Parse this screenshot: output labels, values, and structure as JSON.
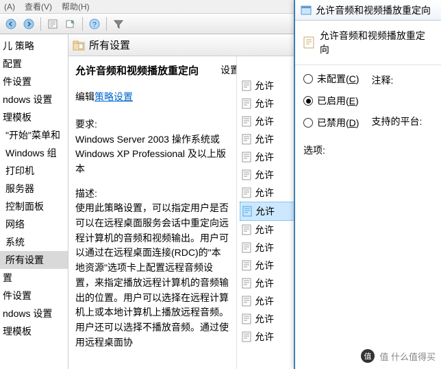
{
  "menubar": {
    "view": "查看(V)",
    "help": "帮助(H)",
    "prefix": "(A)"
  },
  "tree": {
    "items": [
      {
        "label": "儿 策略",
        "lvl": 1
      },
      {
        "label": "配置",
        "lvl": 1
      },
      {
        "label": "件设置",
        "lvl": 1
      },
      {
        "label": "ndows 设置",
        "lvl": 1
      },
      {
        "label": "理模板",
        "lvl": 1
      },
      {
        "label": "\"开始\"菜单和",
        "lvl": 2
      },
      {
        "label": "Windows 组",
        "lvl": 2
      },
      {
        "label": "打印机",
        "lvl": 2
      },
      {
        "label": "服务器",
        "lvl": 2
      },
      {
        "label": "控制面板",
        "lvl": 2
      },
      {
        "label": "网络",
        "lvl": 2
      },
      {
        "label": "系统",
        "lvl": 2
      },
      {
        "label": "所有设置",
        "lvl": 2,
        "sel": true
      },
      {
        "label": "置",
        "lvl": 1
      },
      {
        "label": "件设置",
        "lvl": 1
      },
      {
        "label": "ndows 设置",
        "lvl": 1
      },
      {
        "label": "理模板",
        "lvl": 1
      }
    ]
  },
  "content": {
    "header": "所有设置",
    "title": "允许音频和视频播放重定向",
    "edit_label": "编辑",
    "edit_link": "策略设置",
    "column_settings": "设置",
    "req_label": "要求:",
    "req_text": "Windows Server 2003 操作系统或 Windows XP Professional 及以上版本",
    "desc_label": "描述:",
    "desc_text": "使用此策略设置，可以指定用户是否可以在远程桌面服务会话中重定向远程计算机的音频和视频输出。用户可以通过在远程桌面连接(RDC)的\"本地资源\"选项卡上配置远程音频设置，来指定播放远程计算机的音频输出的位置。用户可以选择在远程计算机上或本地计算机上播放远程音频。用户还可以选择不播放音频。通过使用远程桌面协"
  },
  "setlist": {
    "items": [
      {
        "label": "允许"
      },
      {
        "label": "允许"
      },
      {
        "label": "允许"
      },
      {
        "label": "允许"
      },
      {
        "label": "允许"
      },
      {
        "label": "允许"
      },
      {
        "label": "允许"
      },
      {
        "label": "允许",
        "sel": true
      },
      {
        "label": "允许"
      },
      {
        "label": "允许"
      },
      {
        "label": "允许"
      },
      {
        "label": "允许"
      },
      {
        "label": "允许"
      },
      {
        "label": "允许"
      },
      {
        "label": "允许"
      }
    ]
  },
  "dialog": {
    "title": "允许音频和视频播放重定向",
    "field": "允许音频和视频播放重定向",
    "radios": {
      "not_configured": {
        "label": "未配置",
        "mn": "C"
      },
      "enabled": {
        "label": "已启用",
        "mn": "E"
      },
      "disabled": {
        "label": "已禁用",
        "mn": "D"
      }
    },
    "comment_label": "注释:",
    "platform_label": "支持的平台:",
    "options_label": "选项:"
  },
  "watermark": "值  什么值得买"
}
